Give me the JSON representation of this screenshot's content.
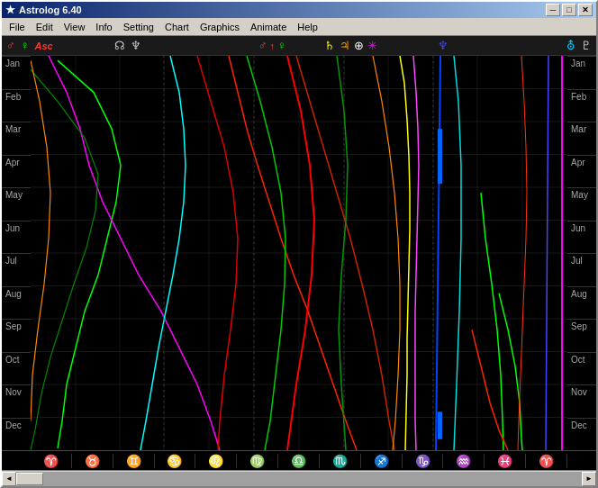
{
  "window": {
    "title": "Astrolog 6.40",
    "icon": "★"
  },
  "titlebar": {
    "minimize": "─",
    "maximize": "□",
    "close": "✕"
  },
  "menu": {
    "items": [
      "File",
      "Edit",
      "View",
      "Info",
      "Setting",
      "Chart",
      "Graphics",
      "Animate",
      "Help"
    ]
  },
  "months": {
    "left": [
      "Jan",
      "Feb",
      "Mar",
      "Apr",
      "May",
      "Jun",
      "Jul",
      "Aug",
      "Sep",
      "Oct",
      "Nov",
      "Dec"
    ],
    "right": [
      "Jan",
      "Feb",
      "Mar",
      "Apr",
      "May",
      "Jun",
      "Jul",
      "Aug",
      "Sep",
      "Oct",
      "Nov",
      "Dec"
    ]
  },
  "zodiac": {
    "symbols": [
      {
        "symbol": "♈",
        "color": "red"
      },
      {
        "symbol": "♉",
        "color": "yellow"
      },
      {
        "symbol": "♊",
        "color": "green"
      },
      {
        "symbol": "♋",
        "color": "blue"
      },
      {
        "symbol": "♌",
        "color": "yellow"
      },
      {
        "symbol": "♍",
        "color": "green"
      },
      {
        "symbol": "♎",
        "color": "red"
      },
      {
        "symbol": "♏",
        "color": "red"
      },
      {
        "symbol": "♐",
        "color": "red"
      },
      {
        "symbol": "♑",
        "color": "green"
      },
      {
        "symbol": "♒",
        "color": "blue"
      },
      {
        "symbol": "♓",
        "color": "green"
      },
      {
        "symbol": "♈",
        "color": "red"
      }
    ]
  },
  "planets": {
    "symbols": [
      {
        "symbol": "♂",
        "color": "#ff4444"
      },
      {
        "symbol": "♀",
        "color": "#00ff00"
      },
      {
        "symbol": "↑",
        "color": "#ff4444"
      },
      {
        "symbol": "Asc",
        "color": "#ff4444"
      },
      {
        "symbol": "☊",
        "color": "#ffffff"
      },
      {
        "symbol": "♆",
        "color": "#ffffff"
      },
      {
        "symbol": "♂↗",
        "color": "#ff4444"
      },
      {
        "symbol": "♀",
        "color": "#00ff00"
      },
      {
        "symbol": "♄",
        "color": "#ffff00"
      },
      {
        "symbol": "♃",
        "color": "#00ff00"
      },
      {
        "symbol": "☿",
        "color": "#00ffff"
      },
      {
        "symbol": "⊕",
        "color": "#ffffff"
      },
      {
        "symbol": "✳",
        "color": "#ff00ff"
      },
      {
        "symbol": "♆",
        "color": "#0000ff"
      },
      {
        "symbol": "♇",
        "color": "#ffffff"
      }
    ]
  }
}
